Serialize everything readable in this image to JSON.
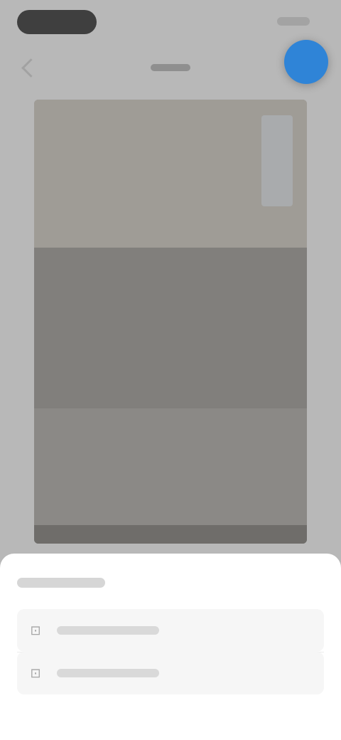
{
  "status_bar": {
    "time": "",
    "indicators": ""
  },
  "top_bar": {
    "title": "",
    "back_icon": "back-icon"
  },
  "fab": {
    "icon": "action-icon",
    "color": "#2f84d7"
  },
  "preview": {
    "label": ""
  },
  "sheet": {
    "title": "",
    "close_icon": "close-icon",
    "options": [
      {
        "label": "",
        "icon": "option-icon"
      },
      {
        "label": "",
        "icon": "option-icon"
      }
    ]
  }
}
